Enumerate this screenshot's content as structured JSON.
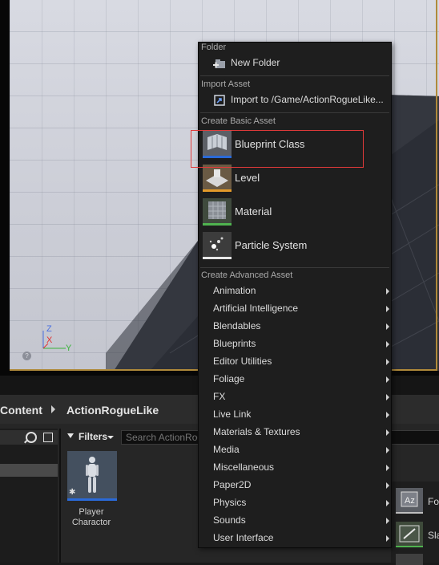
{
  "viewport": {
    "axis": {
      "z": "Z",
      "x": "X",
      "y": "Y"
    },
    "help_icon": "?"
  },
  "content_browser": {
    "path": [
      "Content",
      "ActionRogueLike"
    ],
    "filters_label": "Filters",
    "search_placeholder": "Search ActionRogueLike",
    "assets": [
      {
        "name": "Player Charactor",
        "icon": "character-mannequin-icon"
      }
    ],
    "right_list": [
      {
        "label": "Fo",
        "icon": "font-icon"
      },
      {
        "label": "Sla",
        "icon": "slate-brush-icon"
      }
    ]
  },
  "context_menu": {
    "sections": {
      "folder": "Folder",
      "import": "Import Asset",
      "basic": "Create Basic Asset",
      "advanced": "Create Advanced Asset"
    },
    "new_folder": "New Folder",
    "import_to": "Import to /Game/ActionRogueLike...",
    "basic_assets": [
      {
        "label": "Blueprint Class",
        "icon": "blueprint-class-icon",
        "accent": "#2a6ad8"
      },
      {
        "label": "Level",
        "icon": "level-icon",
        "accent": "#e39a2a"
      },
      {
        "label": "Material",
        "icon": "material-icon",
        "accent": "#4fb34f"
      },
      {
        "label": "Particle System",
        "icon": "particle-system-icon",
        "accent": "#e8e8e8"
      }
    ],
    "advanced_assets": [
      "Animation",
      "Artificial Intelligence",
      "Blendables",
      "Blueprints",
      "Editor Utilities",
      "Foliage",
      "FX",
      "Live Link",
      "Materials & Textures",
      "Media",
      "Miscellaneous",
      "Paper2D",
      "Physics",
      "Sounds",
      "User Interface"
    ],
    "highlighted_item": "Blueprint Class",
    "highlight_color": "#e03a3a"
  }
}
